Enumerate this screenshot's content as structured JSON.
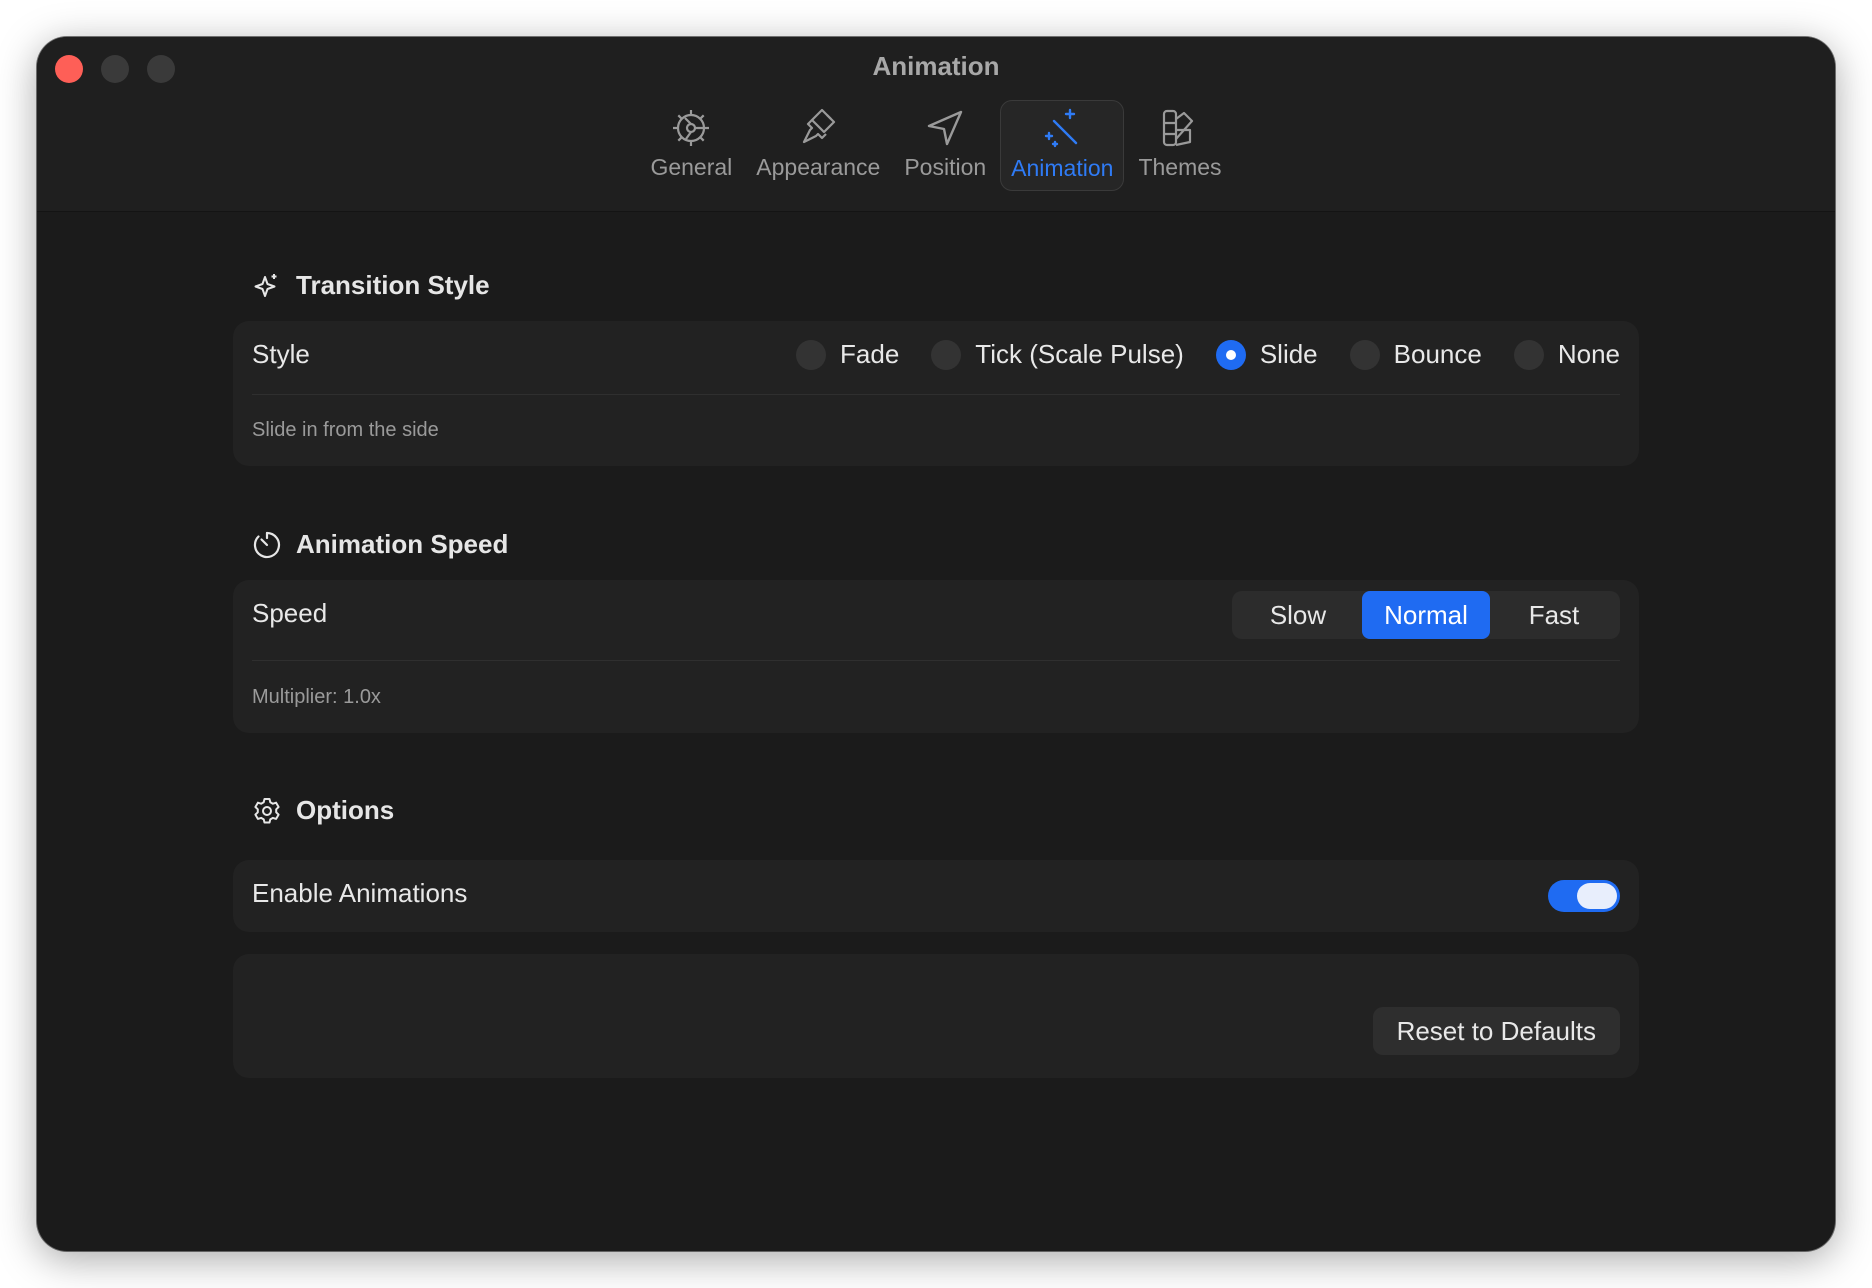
{
  "window": {
    "title": "Animation"
  },
  "tabs": [
    {
      "label": "General",
      "icon": "gear-icon",
      "active": false
    },
    {
      "label": "Appearance",
      "icon": "paintbrush-icon",
      "active": false
    },
    {
      "label": "Position",
      "icon": "location-arrow-icon",
      "active": false
    },
    {
      "label": "Animation",
      "icon": "magic-wand-icon",
      "active": true
    },
    {
      "label": "Themes",
      "icon": "swatch-book-icon",
      "active": false
    }
  ],
  "transition": {
    "header": "Transition Style",
    "icon": "sparkles-icon",
    "row_label": "Style",
    "options": [
      "Fade",
      "Tick (Scale Pulse)",
      "Slide",
      "Bounce",
      "None"
    ],
    "selected": "Slide",
    "caption": "Slide in from the side"
  },
  "speed": {
    "header": "Animation Speed",
    "icon": "timer-icon",
    "row_label": "Speed",
    "options": [
      "Slow",
      "Normal",
      "Fast"
    ],
    "selected": "Normal",
    "caption": "Multiplier: 1.0x"
  },
  "options": {
    "header": "Options",
    "icon": "gear-icon",
    "enable_label": "Enable Animations",
    "enabled": true
  },
  "actions": {
    "reset_label": "Reset to Defaults"
  },
  "colors": {
    "accent": "#1f6bf2",
    "close": "#fe5f57",
    "background": "#1b1b1b"
  }
}
